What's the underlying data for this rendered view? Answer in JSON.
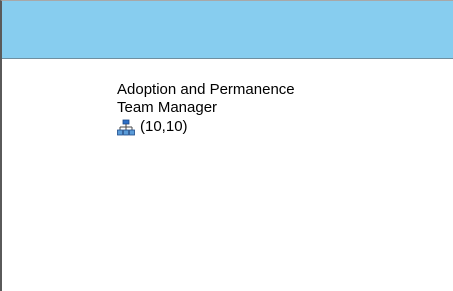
{
  "header": {
    "background": "#87cdef"
  },
  "node": {
    "title_line1": "Adoption and Permanence",
    "title_line2": "Team Manager",
    "count": "(10,10)",
    "icon": "org-chart-icon"
  }
}
